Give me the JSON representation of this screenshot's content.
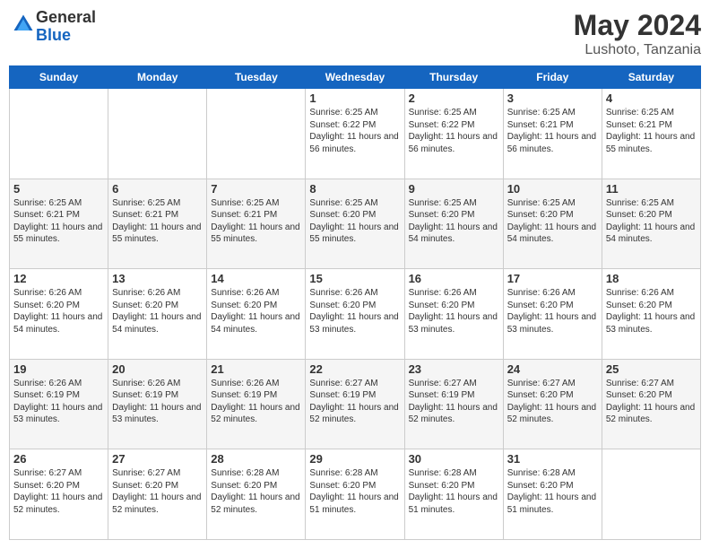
{
  "header": {
    "logo_general": "General",
    "logo_blue": "Blue",
    "month_year": "May 2024",
    "location": "Lushoto, Tanzania"
  },
  "days_of_week": [
    "Sunday",
    "Monday",
    "Tuesday",
    "Wednesday",
    "Thursday",
    "Friday",
    "Saturday"
  ],
  "weeks": [
    [
      {
        "day": "",
        "text": ""
      },
      {
        "day": "",
        "text": ""
      },
      {
        "day": "",
        "text": ""
      },
      {
        "day": "1",
        "text": "Sunrise: 6:25 AM\nSunset: 6:22 PM\nDaylight: 11 hours and 56 minutes."
      },
      {
        "day": "2",
        "text": "Sunrise: 6:25 AM\nSunset: 6:22 PM\nDaylight: 11 hours and 56 minutes."
      },
      {
        "day": "3",
        "text": "Sunrise: 6:25 AM\nSunset: 6:21 PM\nDaylight: 11 hours and 56 minutes."
      },
      {
        "day": "4",
        "text": "Sunrise: 6:25 AM\nSunset: 6:21 PM\nDaylight: 11 hours and 55 minutes."
      }
    ],
    [
      {
        "day": "5",
        "text": "Sunrise: 6:25 AM\nSunset: 6:21 PM\nDaylight: 11 hours and 55 minutes."
      },
      {
        "day": "6",
        "text": "Sunrise: 6:25 AM\nSunset: 6:21 PM\nDaylight: 11 hours and 55 minutes."
      },
      {
        "day": "7",
        "text": "Sunrise: 6:25 AM\nSunset: 6:21 PM\nDaylight: 11 hours and 55 minutes."
      },
      {
        "day": "8",
        "text": "Sunrise: 6:25 AM\nSunset: 6:20 PM\nDaylight: 11 hours and 55 minutes."
      },
      {
        "day": "9",
        "text": "Sunrise: 6:25 AM\nSunset: 6:20 PM\nDaylight: 11 hours and 54 minutes."
      },
      {
        "day": "10",
        "text": "Sunrise: 6:25 AM\nSunset: 6:20 PM\nDaylight: 11 hours and 54 minutes."
      },
      {
        "day": "11",
        "text": "Sunrise: 6:25 AM\nSunset: 6:20 PM\nDaylight: 11 hours and 54 minutes."
      }
    ],
    [
      {
        "day": "12",
        "text": "Sunrise: 6:26 AM\nSunset: 6:20 PM\nDaylight: 11 hours and 54 minutes."
      },
      {
        "day": "13",
        "text": "Sunrise: 6:26 AM\nSunset: 6:20 PM\nDaylight: 11 hours and 54 minutes."
      },
      {
        "day": "14",
        "text": "Sunrise: 6:26 AM\nSunset: 6:20 PM\nDaylight: 11 hours and 54 minutes."
      },
      {
        "day": "15",
        "text": "Sunrise: 6:26 AM\nSunset: 6:20 PM\nDaylight: 11 hours and 53 minutes."
      },
      {
        "day": "16",
        "text": "Sunrise: 6:26 AM\nSunset: 6:20 PM\nDaylight: 11 hours and 53 minutes."
      },
      {
        "day": "17",
        "text": "Sunrise: 6:26 AM\nSunset: 6:20 PM\nDaylight: 11 hours and 53 minutes."
      },
      {
        "day": "18",
        "text": "Sunrise: 6:26 AM\nSunset: 6:20 PM\nDaylight: 11 hours and 53 minutes."
      }
    ],
    [
      {
        "day": "19",
        "text": "Sunrise: 6:26 AM\nSunset: 6:19 PM\nDaylight: 11 hours and 53 minutes."
      },
      {
        "day": "20",
        "text": "Sunrise: 6:26 AM\nSunset: 6:19 PM\nDaylight: 11 hours and 53 minutes."
      },
      {
        "day": "21",
        "text": "Sunrise: 6:26 AM\nSunset: 6:19 PM\nDaylight: 11 hours and 52 minutes."
      },
      {
        "day": "22",
        "text": "Sunrise: 6:27 AM\nSunset: 6:19 PM\nDaylight: 11 hours and 52 minutes."
      },
      {
        "day": "23",
        "text": "Sunrise: 6:27 AM\nSunset: 6:19 PM\nDaylight: 11 hours and 52 minutes."
      },
      {
        "day": "24",
        "text": "Sunrise: 6:27 AM\nSunset: 6:20 PM\nDaylight: 11 hours and 52 minutes."
      },
      {
        "day": "25",
        "text": "Sunrise: 6:27 AM\nSunset: 6:20 PM\nDaylight: 11 hours and 52 minutes."
      }
    ],
    [
      {
        "day": "26",
        "text": "Sunrise: 6:27 AM\nSunset: 6:20 PM\nDaylight: 11 hours and 52 minutes."
      },
      {
        "day": "27",
        "text": "Sunrise: 6:27 AM\nSunset: 6:20 PM\nDaylight: 11 hours and 52 minutes."
      },
      {
        "day": "28",
        "text": "Sunrise: 6:28 AM\nSunset: 6:20 PM\nDaylight: 11 hours and 52 minutes."
      },
      {
        "day": "29",
        "text": "Sunrise: 6:28 AM\nSunset: 6:20 PM\nDaylight: 11 hours and 51 minutes."
      },
      {
        "day": "30",
        "text": "Sunrise: 6:28 AM\nSunset: 6:20 PM\nDaylight: 11 hours and 51 minutes."
      },
      {
        "day": "31",
        "text": "Sunrise: 6:28 AM\nSunset: 6:20 PM\nDaylight: 11 hours and 51 minutes."
      },
      {
        "day": "",
        "text": ""
      }
    ]
  ]
}
